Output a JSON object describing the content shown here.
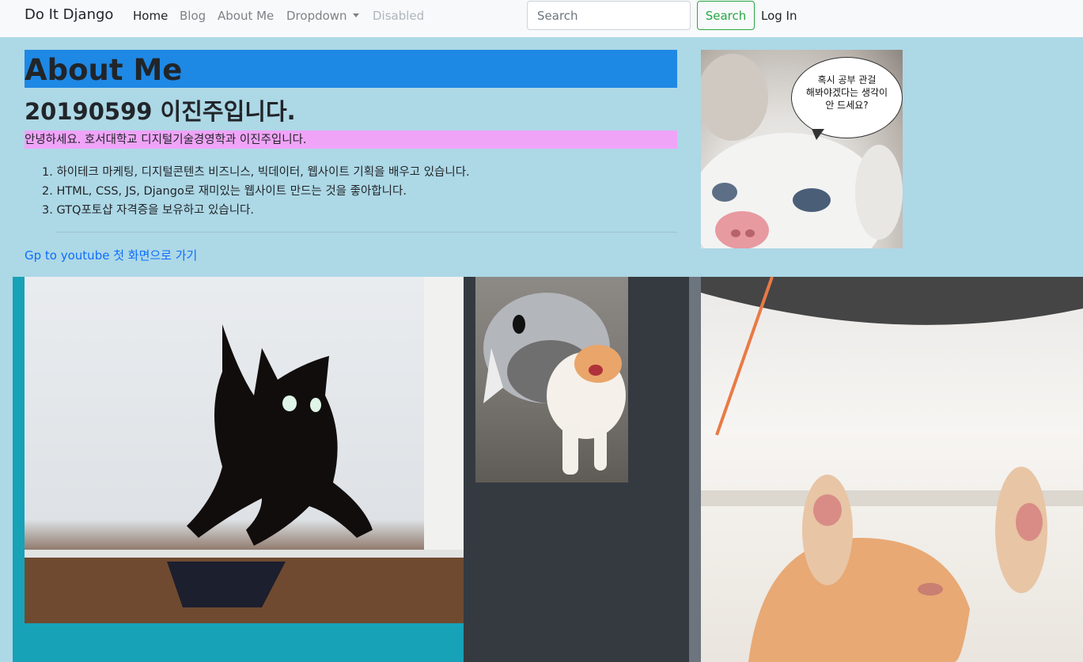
{
  "navbar": {
    "brand": "Do It Django",
    "links": [
      {
        "label": "Home",
        "state": "active"
      },
      {
        "label": "Blog",
        "state": "normal"
      },
      {
        "label": "About Me",
        "state": "normal"
      },
      {
        "label": "Dropdown",
        "state": "normal"
      },
      {
        "label": "Disabled",
        "state": "disabled"
      }
    ],
    "search": {
      "placeholder": "Search",
      "button": "Search"
    },
    "login": "Log In"
  },
  "about": {
    "title": "About Me",
    "student_id": "20190599",
    "name_line": "이진주입니다.",
    "intro": "안녕하세요. 호서대학교 디지털기술경영학과 이진주입니다.",
    "list": [
      "하이테크 마케팅, 디지털콘텐츠 비즈니스, 빅데이터, 웹사이트 기획을 배우고 있습니다.",
      "HTML, CSS, JS, Django로 재미있는 웹사이트 만드는 것을 좋아합니다.",
      "GTQ포토샵 자격증을 보유하고 있습니다."
    ],
    "list_numbers": [
      "1.",
      "2.",
      "3."
    ],
    "link": "Gp to youtube 첫 화면으로 가기"
  },
  "speech_bubble": {
    "lines": [
      "혹시 공부 관걸",
      "해봐야겠다는 생각이",
      "안 드세요?"
    ]
  },
  "colors": {
    "page_bg": "#add8e6",
    "title_bg": "#1e88e5",
    "intro_bg": "#f0a4f8",
    "col1_bg": "#17a2b8",
    "col2_bg": "#343a40",
    "col3_bg": "#6c757d"
  }
}
